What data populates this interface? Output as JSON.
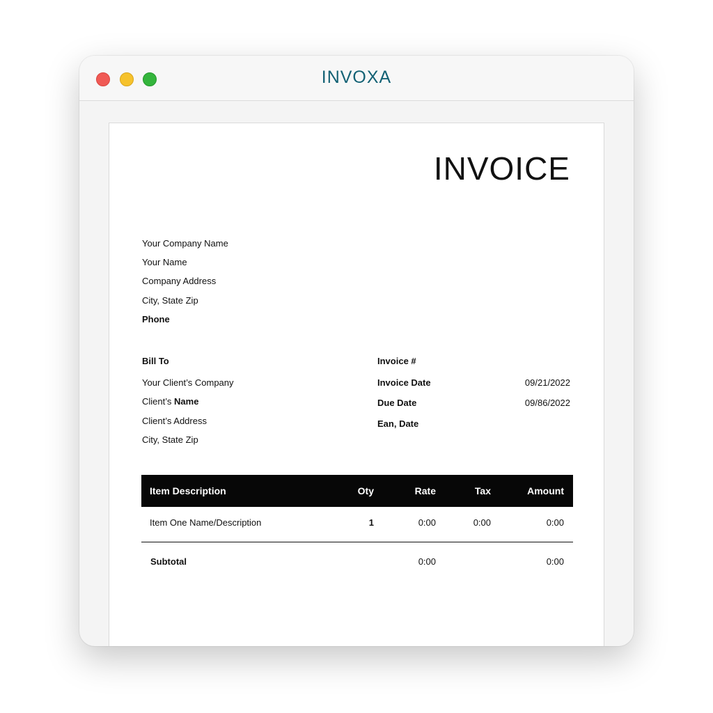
{
  "window": {
    "app_title": "INVOXA"
  },
  "invoice": {
    "title": "INVOICE",
    "sender": {
      "company_name": "Your Company Name",
      "name": "Your Name",
      "address": "Company Address",
      "city_state_zip": "City, State Zip",
      "phone_label": "Phone"
    },
    "bill_to": {
      "label": "Bill To",
      "company": "Your Client’s Company",
      "name_prefix": "Client’s",
      "name_bold": "Name",
      "address": "Client’s Address",
      "city_state_zip": "City, State Zip"
    },
    "details": {
      "invoice_number_label": "Invoice #",
      "invoice_date_label": "Invoice Date",
      "invoice_date_value": "09/21/2022",
      "due_date_label": "Due Date",
      "due_date_value": "09/86/2022",
      "extra_label": "Ean, Date"
    },
    "table": {
      "headers": {
        "description": "Item Description",
        "qty": "Oty",
        "rate": "Rate",
        "tax": "Tax",
        "amount": "Amount"
      },
      "rows": [
        {
          "description": "Item One Name/Description",
          "qty": "1",
          "rate": "0:00",
          "tax": "0:00",
          "amount": "0:00"
        }
      ],
      "subtotal": {
        "label": "Subtotal",
        "rate": "0:00",
        "amount": "0:00"
      }
    }
  }
}
